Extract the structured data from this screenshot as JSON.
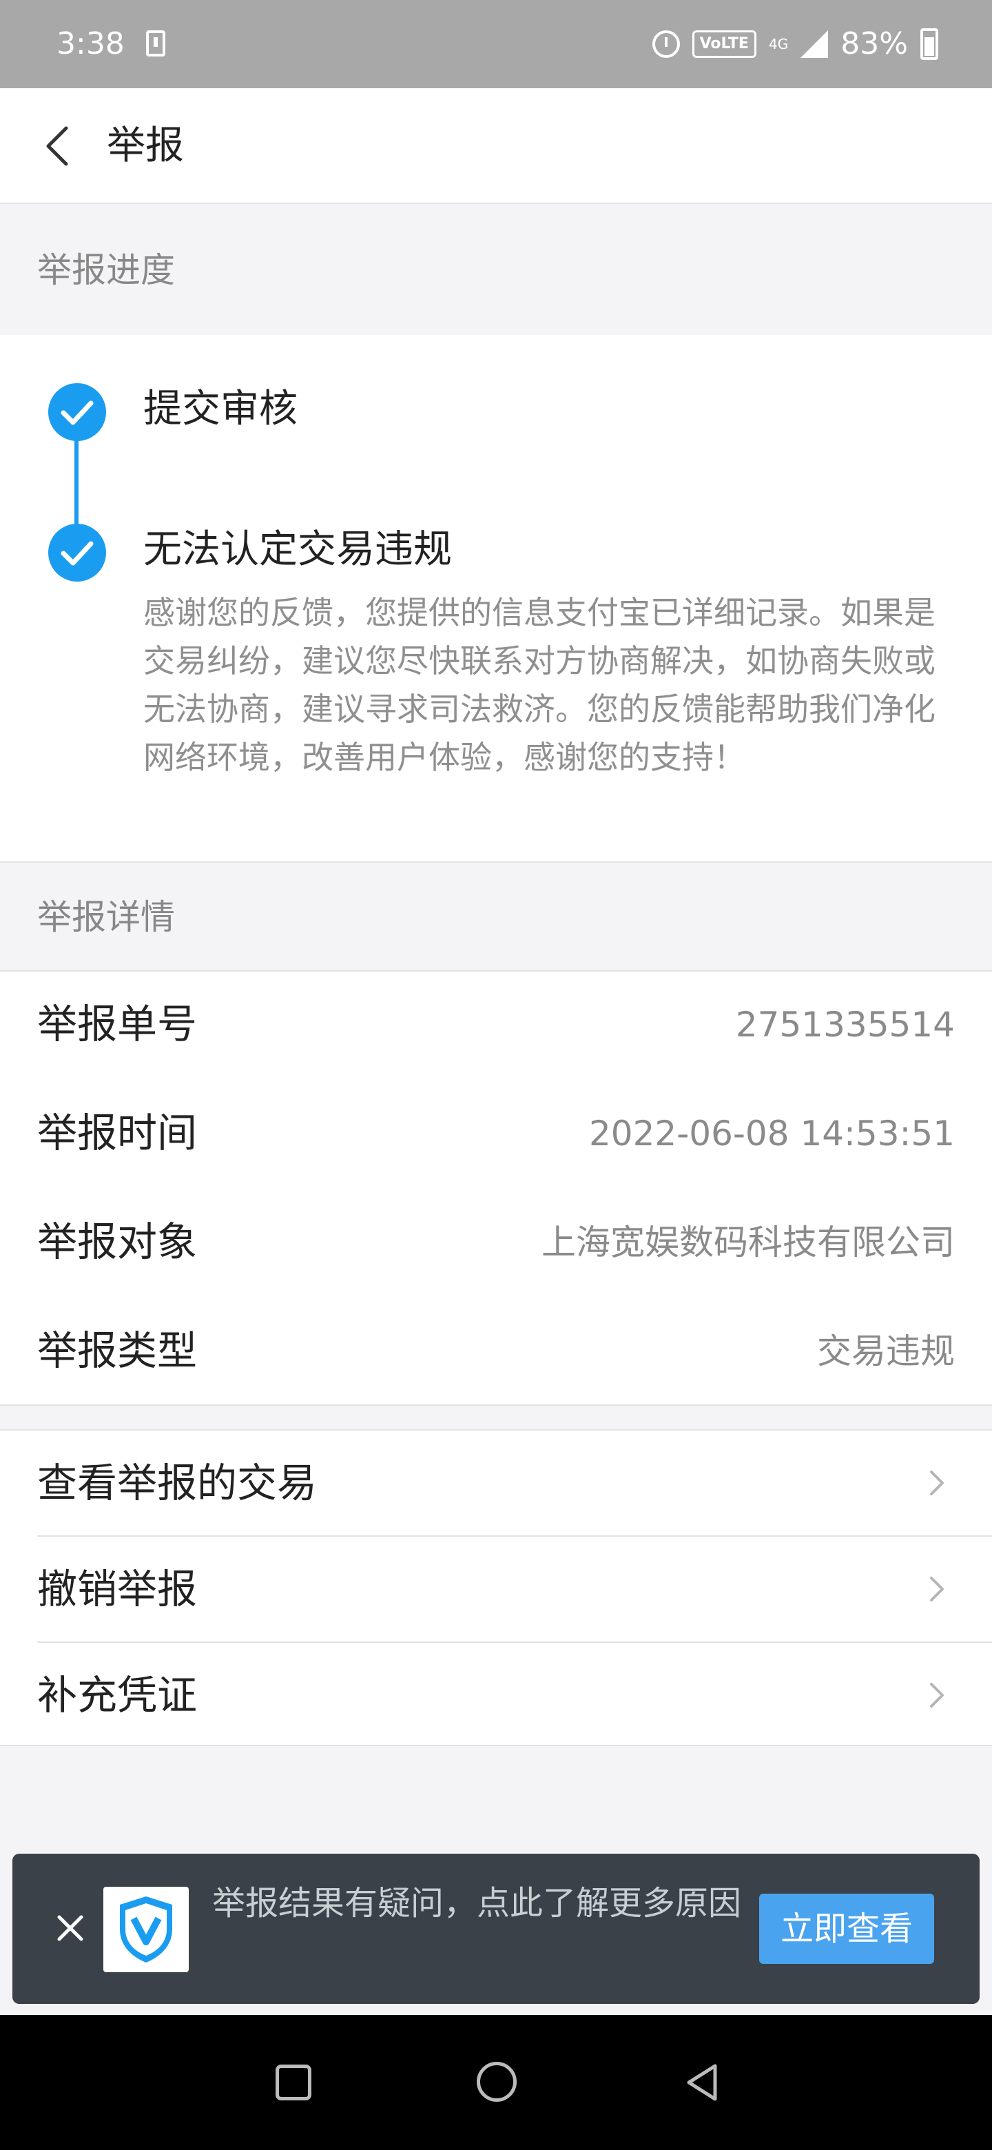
{
  "status_bar": {
    "time": "3:38",
    "volte": "VoLTE",
    "network": "4G",
    "battery": "83%"
  },
  "header": {
    "title": "举报"
  },
  "progress": {
    "section_title": "举报进度",
    "steps": [
      {
        "title": "提交审核"
      },
      {
        "title": "无法认定交易违规",
        "description": "感谢您的反馈，您提供的信息支付宝已详细记录。如果是交易纠纷，建议您尽快联系对方协商解决，如协商失败或无法协商，建议寻求司法救济。您的反馈能帮助我们净化网络环境，改善用户体验，感谢您的支持！"
      }
    ]
  },
  "details": {
    "section_title": "举报详情",
    "rows": [
      {
        "label": "举报单号",
        "value": "2751335514"
      },
      {
        "label": "举报时间",
        "value": "2022-06-08 14:53:51"
      },
      {
        "label": "举报对象",
        "value": "上海宽娱数码科技有限公司"
      },
      {
        "label": "举报类型",
        "value": "交易违规"
      }
    ]
  },
  "actions": [
    {
      "label": "查看举报的交易"
    },
    {
      "label": "撤销举报"
    },
    {
      "label": "补充凭证"
    }
  ],
  "banner": {
    "text": "举报结果有疑问，点此了解更多原因",
    "button": "立即查看"
  },
  "colors": {
    "accent": "#1a9df0",
    "banner_bg": "#3a4148",
    "banner_button": "#4aa3ee"
  }
}
